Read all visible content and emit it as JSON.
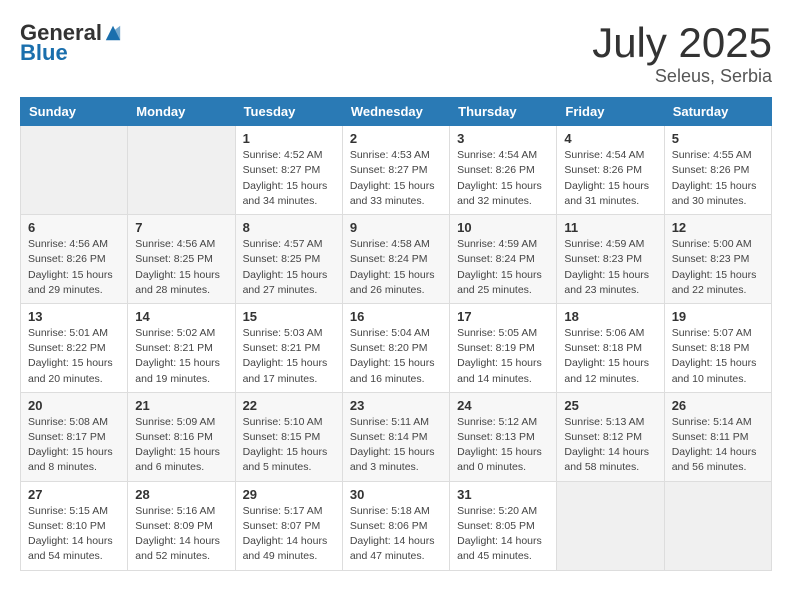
{
  "header": {
    "logo_general": "General",
    "logo_blue": "Blue",
    "month": "July 2025",
    "location": "Seleus, Serbia"
  },
  "days_of_week": [
    "Sunday",
    "Monday",
    "Tuesday",
    "Wednesday",
    "Thursday",
    "Friday",
    "Saturday"
  ],
  "weeks": [
    [
      {
        "day": "",
        "info": ""
      },
      {
        "day": "",
        "info": ""
      },
      {
        "day": "1",
        "info": "Sunrise: 4:52 AM\nSunset: 8:27 PM\nDaylight: 15 hours and 34 minutes."
      },
      {
        "day": "2",
        "info": "Sunrise: 4:53 AM\nSunset: 8:27 PM\nDaylight: 15 hours and 33 minutes."
      },
      {
        "day": "3",
        "info": "Sunrise: 4:54 AM\nSunset: 8:26 PM\nDaylight: 15 hours and 32 minutes."
      },
      {
        "day": "4",
        "info": "Sunrise: 4:54 AM\nSunset: 8:26 PM\nDaylight: 15 hours and 31 minutes."
      },
      {
        "day": "5",
        "info": "Sunrise: 4:55 AM\nSunset: 8:26 PM\nDaylight: 15 hours and 30 minutes."
      }
    ],
    [
      {
        "day": "6",
        "info": "Sunrise: 4:56 AM\nSunset: 8:26 PM\nDaylight: 15 hours and 29 minutes."
      },
      {
        "day": "7",
        "info": "Sunrise: 4:56 AM\nSunset: 8:25 PM\nDaylight: 15 hours and 28 minutes."
      },
      {
        "day": "8",
        "info": "Sunrise: 4:57 AM\nSunset: 8:25 PM\nDaylight: 15 hours and 27 minutes."
      },
      {
        "day": "9",
        "info": "Sunrise: 4:58 AM\nSunset: 8:24 PM\nDaylight: 15 hours and 26 minutes."
      },
      {
        "day": "10",
        "info": "Sunrise: 4:59 AM\nSunset: 8:24 PM\nDaylight: 15 hours and 25 minutes."
      },
      {
        "day": "11",
        "info": "Sunrise: 4:59 AM\nSunset: 8:23 PM\nDaylight: 15 hours and 23 minutes."
      },
      {
        "day": "12",
        "info": "Sunrise: 5:00 AM\nSunset: 8:23 PM\nDaylight: 15 hours and 22 minutes."
      }
    ],
    [
      {
        "day": "13",
        "info": "Sunrise: 5:01 AM\nSunset: 8:22 PM\nDaylight: 15 hours and 20 minutes."
      },
      {
        "day": "14",
        "info": "Sunrise: 5:02 AM\nSunset: 8:21 PM\nDaylight: 15 hours and 19 minutes."
      },
      {
        "day": "15",
        "info": "Sunrise: 5:03 AM\nSunset: 8:21 PM\nDaylight: 15 hours and 17 minutes."
      },
      {
        "day": "16",
        "info": "Sunrise: 5:04 AM\nSunset: 8:20 PM\nDaylight: 15 hours and 16 minutes."
      },
      {
        "day": "17",
        "info": "Sunrise: 5:05 AM\nSunset: 8:19 PM\nDaylight: 15 hours and 14 minutes."
      },
      {
        "day": "18",
        "info": "Sunrise: 5:06 AM\nSunset: 8:18 PM\nDaylight: 15 hours and 12 minutes."
      },
      {
        "day": "19",
        "info": "Sunrise: 5:07 AM\nSunset: 8:18 PM\nDaylight: 15 hours and 10 minutes."
      }
    ],
    [
      {
        "day": "20",
        "info": "Sunrise: 5:08 AM\nSunset: 8:17 PM\nDaylight: 15 hours and 8 minutes."
      },
      {
        "day": "21",
        "info": "Sunrise: 5:09 AM\nSunset: 8:16 PM\nDaylight: 15 hours and 6 minutes."
      },
      {
        "day": "22",
        "info": "Sunrise: 5:10 AM\nSunset: 8:15 PM\nDaylight: 15 hours and 5 minutes."
      },
      {
        "day": "23",
        "info": "Sunrise: 5:11 AM\nSunset: 8:14 PM\nDaylight: 15 hours and 3 minutes."
      },
      {
        "day": "24",
        "info": "Sunrise: 5:12 AM\nSunset: 8:13 PM\nDaylight: 15 hours and 0 minutes."
      },
      {
        "day": "25",
        "info": "Sunrise: 5:13 AM\nSunset: 8:12 PM\nDaylight: 14 hours and 58 minutes."
      },
      {
        "day": "26",
        "info": "Sunrise: 5:14 AM\nSunset: 8:11 PM\nDaylight: 14 hours and 56 minutes."
      }
    ],
    [
      {
        "day": "27",
        "info": "Sunrise: 5:15 AM\nSunset: 8:10 PM\nDaylight: 14 hours and 54 minutes."
      },
      {
        "day": "28",
        "info": "Sunrise: 5:16 AM\nSunset: 8:09 PM\nDaylight: 14 hours and 52 minutes."
      },
      {
        "day": "29",
        "info": "Sunrise: 5:17 AM\nSunset: 8:07 PM\nDaylight: 14 hours and 49 minutes."
      },
      {
        "day": "30",
        "info": "Sunrise: 5:18 AM\nSunset: 8:06 PM\nDaylight: 14 hours and 47 minutes."
      },
      {
        "day": "31",
        "info": "Sunrise: 5:20 AM\nSunset: 8:05 PM\nDaylight: 14 hours and 45 minutes."
      },
      {
        "day": "",
        "info": ""
      },
      {
        "day": "",
        "info": ""
      }
    ]
  ]
}
